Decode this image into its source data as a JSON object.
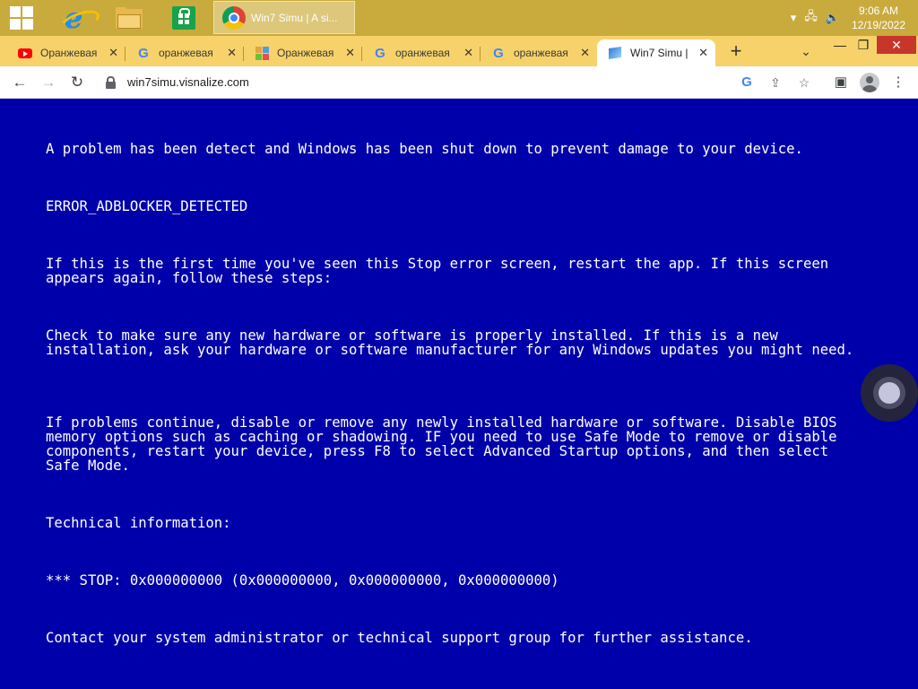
{
  "taskbar": {
    "pinned": [
      {
        "name": "windows-start-icon"
      },
      {
        "name": "internet-explorer-icon",
        "glyph": "e"
      },
      {
        "name": "file-explorer-icon"
      },
      {
        "name": "store-icon"
      }
    ],
    "active_window_label": "Win7 Simu | A si...",
    "clock_time": "9:06 AM",
    "clock_date": "12/19/2022",
    "tray_icons": [
      "chevron-up-icon",
      "network-icon",
      "volume-icon"
    ],
    "colors": {
      "taskbar_bg": "#c9aa3d",
      "tabstrip_bg": "#f7d26b"
    }
  },
  "browser": {
    "tabs": [
      {
        "label": "Оранжевая",
        "favicon": "youtube-icon"
      },
      {
        "label": "оранжевая",
        "favicon": "google-icon"
      },
      {
        "label": "Оранжевая",
        "favicon": "multicolor-icon"
      },
      {
        "label": "оранжевая",
        "favicon": "google-icon"
      },
      {
        "label": "оранжевая",
        "favicon": "google-icon"
      },
      {
        "label": "Win7 Simu |",
        "favicon": "win7-icon",
        "active": true
      }
    ],
    "new_tab_symbol": "+",
    "url": "win7simu.visnalize.com",
    "window_controls": {
      "minimize": "—",
      "restore": "❐",
      "close": "✕"
    }
  },
  "bsod": {
    "background": "#0000aa",
    "line1": "A problem has been detect and Windows has been shut down to prevent damage to your device.",
    "error_code": "ERROR_ADBLOCKER_DETECTED",
    "para1": "If this is the first time you've seen this Stop error screen, restart the app. If this screen appears again, follow these steps:",
    "para2": "Check to make sure any new hardware or software is properly installed. If this is a new installation, ask your hardware or software manufacturer for any Windows updates you might need.",
    "para3": "If problems continue, disable or remove any newly installed hardware or software. Disable BIOS memory options such as caching or shadowing. IF you need to use Safe Mode to remove or disable components, restart your device, press F8 to select Advanced Startup options, and then select Safe Mode.",
    "tech_heading": "Technical information:",
    "stop_line": "*** STOP: 0x000000000 (0x000000000, 0x000000000, 0x000000000)",
    "contact": "Contact your system administrator or technical support group for further assistance."
  }
}
